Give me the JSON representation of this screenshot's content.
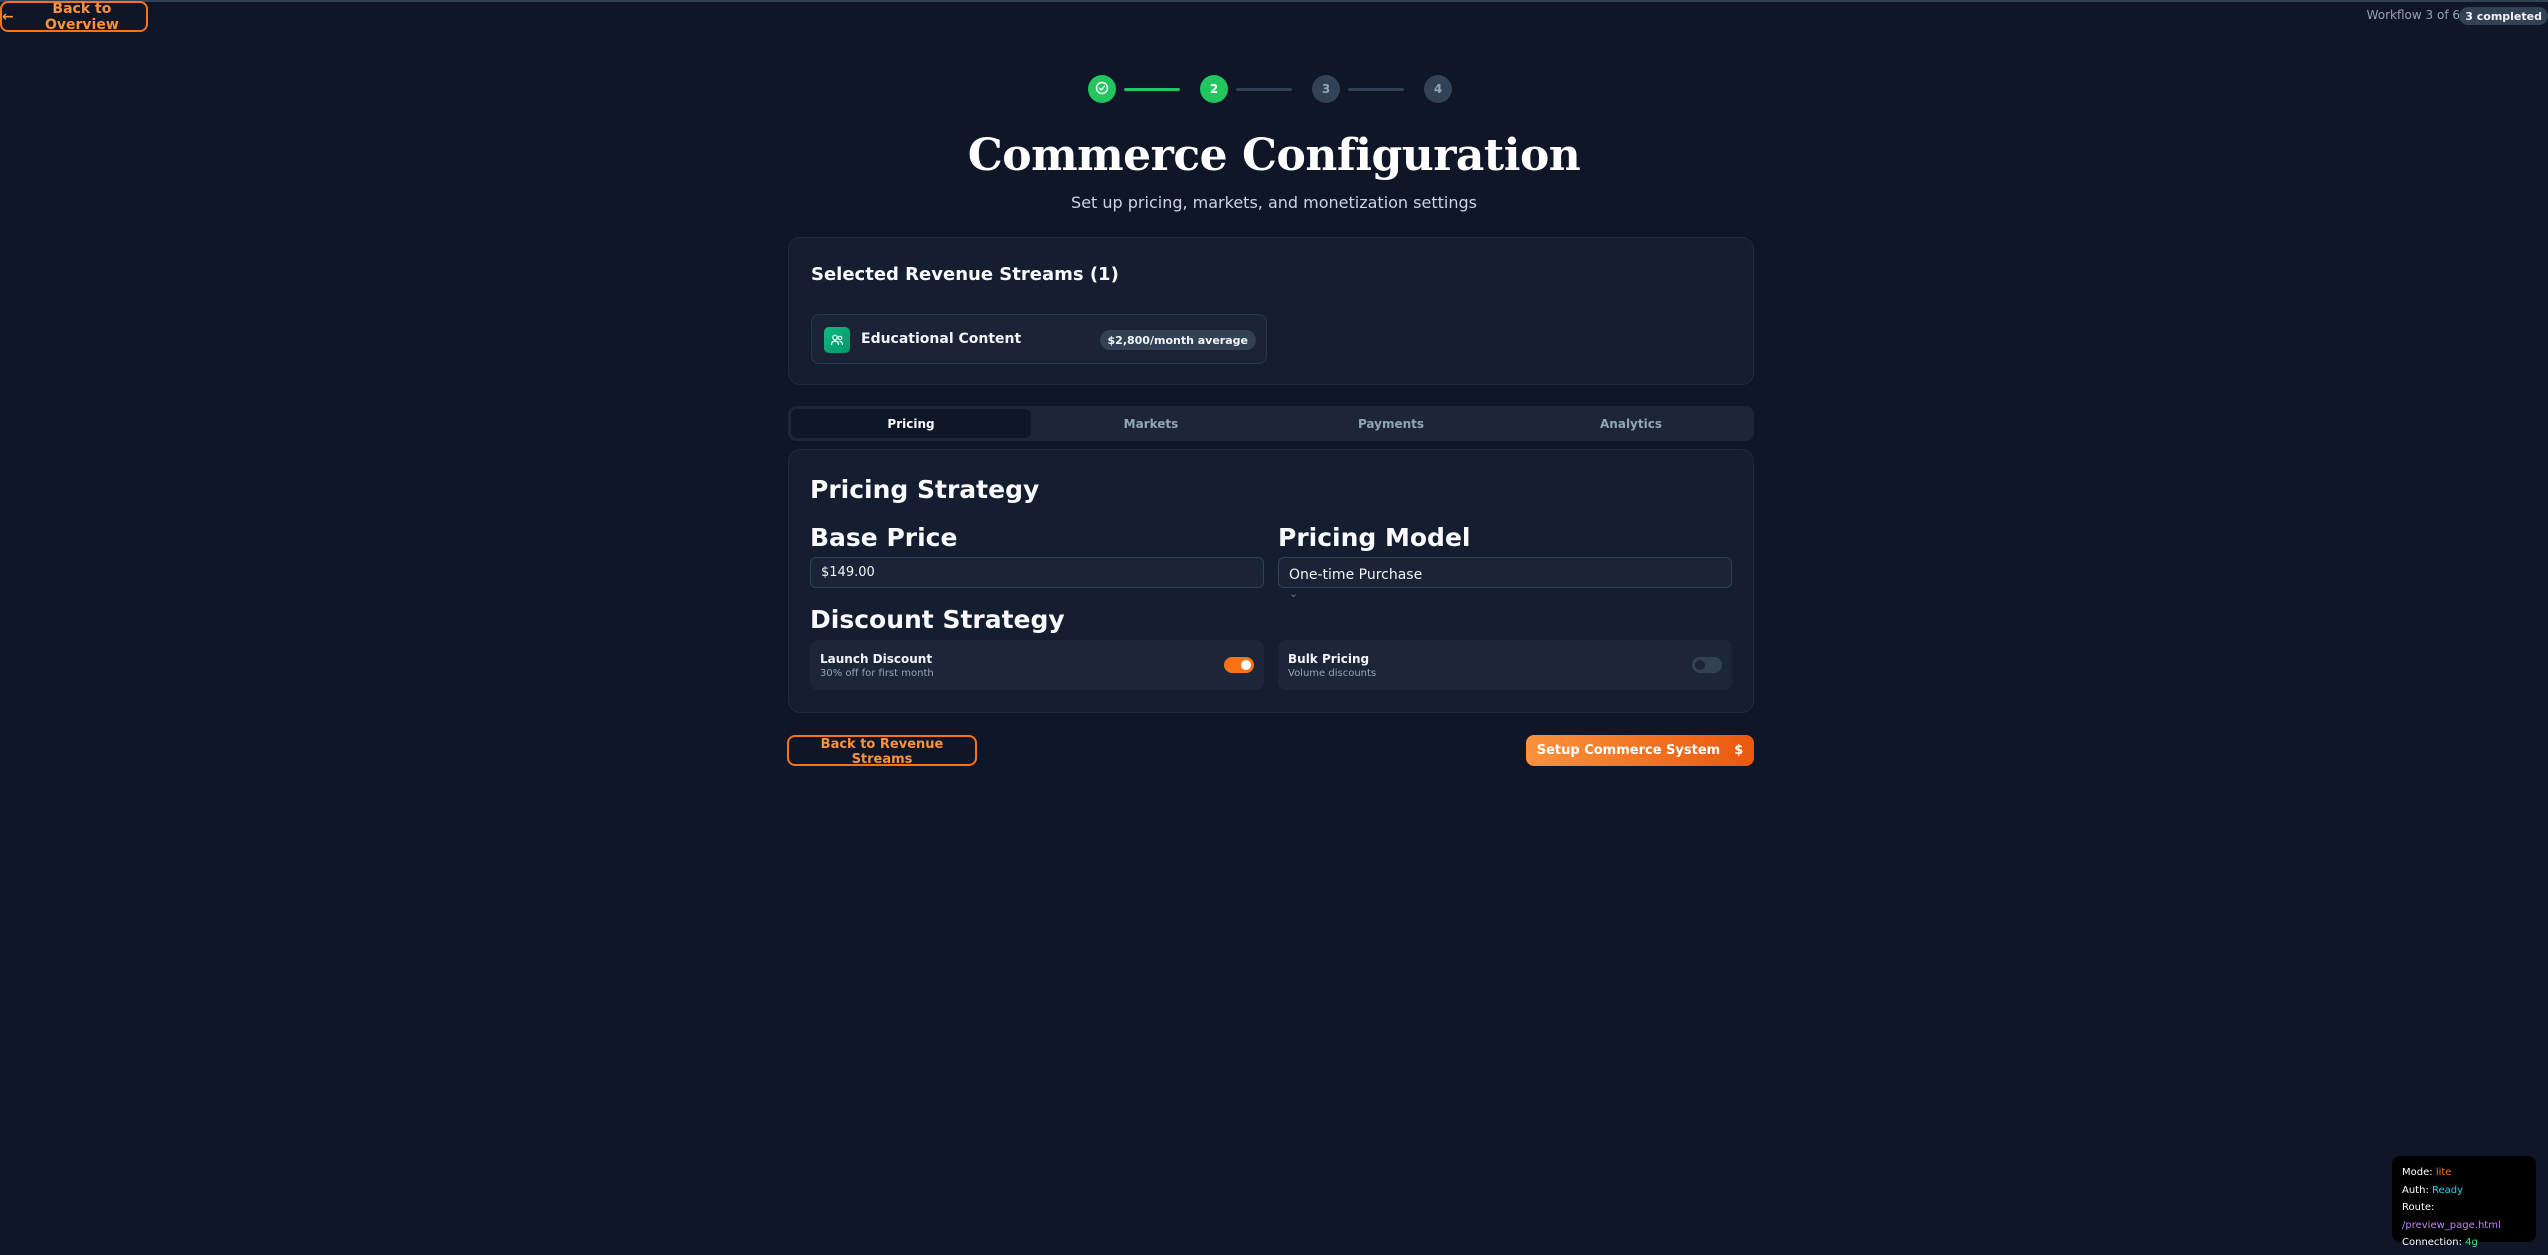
{
  "header": {
    "back_label": "Back to Overview",
    "workflow_text": "Workflow 3 of 6",
    "completed_badge": "3 completed"
  },
  "stepper": {
    "steps": [
      "1",
      "2",
      "3",
      "4"
    ],
    "completed_steps": 1,
    "active_step": 2
  },
  "page": {
    "title": "Commerce Configuration",
    "subtitle": "Set up pricing, markets, and monetization settings"
  },
  "streams": {
    "title": "Selected Revenue Streams (1)",
    "items": [
      {
        "name": "Educational Content",
        "badge": "$2,800/month average",
        "icon": "users-icon"
      }
    ]
  },
  "tabs": [
    {
      "label": "Pricing",
      "active": true
    },
    {
      "label": "Markets",
      "active": false
    },
    {
      "label": "Payments",
      "active": false
    },
    {
      "label": "Analytics",
      "active": false
    }
  ],
  "pricing": {
    "heading": "Pricing Strategy",
    "base_price_label": "Base Price",
    "base_price_value": "$149.00",
    "model_label": "Pricing Model",
    "model_value": "One-time Purchase",
    "discount_heading": "Discount Strategy",
    "discounts": [
      {
        "title": "Launch Discount",
        "desc": "30% off for first month",
        "enabled": true
      },
      {
        "title": "Bulk Pricing",
        "desc": "Volume discounts",
        "enabled": false
      }
    ]
  },
  "actions": {
    "back_label": "Back to Revenue Streams",
    "setup_label": "Setup Commerce System",
    "setup_icon": "$"
  },
  "debug": {
    "mode_label": "Mode:",
    "mode_value": "lite",
    "auth_label": "Auth:",
    "auth_value": "Ready",
    "route_label": "Route:",
    "route_value": "/preview_page.html",
    "conn_label": "Connection:",
    "conn_value": "4g"
  },
  "colors": {
    "background": "#0e1627",
    "accent": "#f97316",
    "success": "#22c55e"
  }
}
